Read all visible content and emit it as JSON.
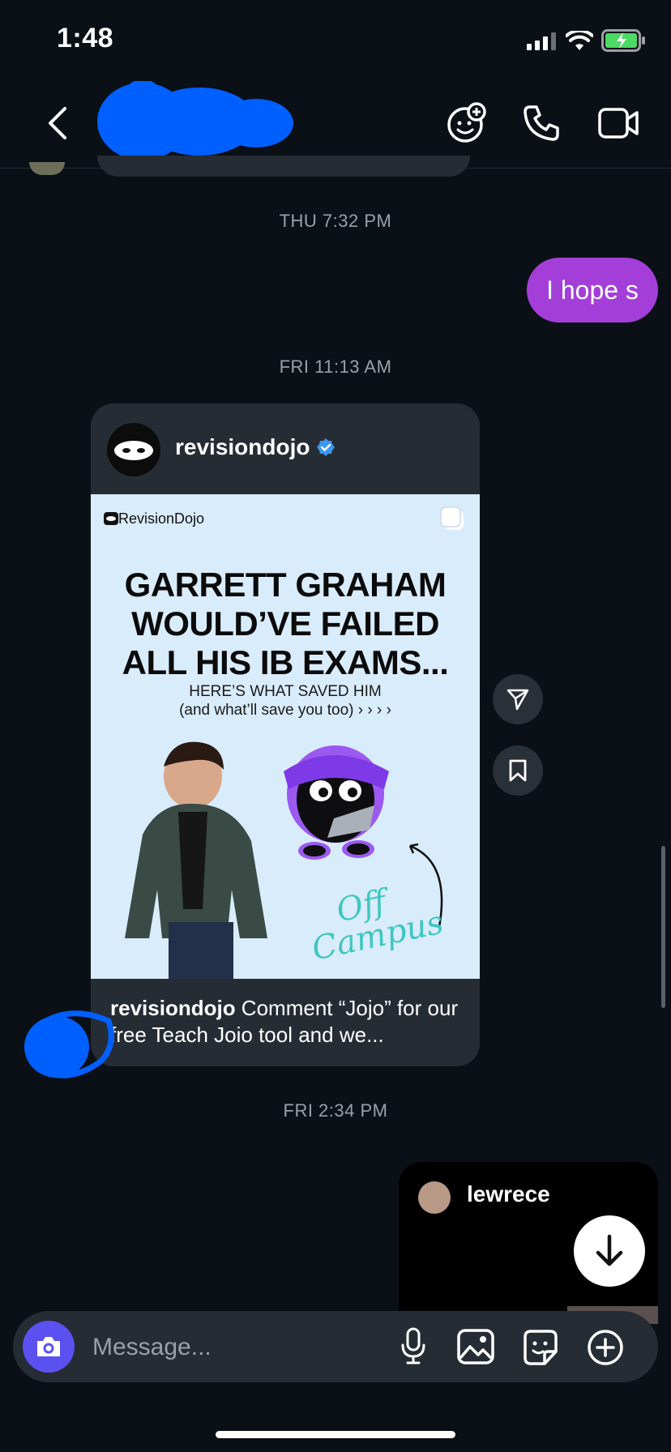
{
  "status_bar": {
    "time": "1:48",
    "battery_icon": "battery-charging-icon"
  },
  "header": {
    "contact_name": "",
    "icons": [
      "back-chevron-icon",
      "sticker-add-icon",
      "phone-icon",
      "video-camera-icon"
    ]
  },
  "thread": {
    "timestamps": [
      "THU 7:32 PM",
      "FRI 11:13 AM",
      "FRI 2:34 PM"
    ],
    "outgoing_message": "I hope s",
    "shared_post": {
      "username": "revisiondojo",
      "verified": true,
      "brand_name": "RevisionDojo",
      "headline_lines": [
        "GARRETT GRAHAM",
        "WOULD’VE FAILED",
        "ALL HIS IB EXAMS..."
      ],
      "subhead_lines": [
        "HERE’S WHAT SAVED HIM",
        "(and what’ll save you too) › › › ›"
      ],
      "doodle_text": "Off Campus",
      "caption_user": "revisiondojo",
      "caption_text": " Comment “Jojo” for our free Teach Joio tool and we..."
    },
    "shared_reel": {
      "username": "lewrece"
    }
  },
  "composer": {
    "placeholder": "Message..."
  },
  "colors": {
    "background": "#0b1017",
    "outgoing_bubble": "#a33fd8",
    "card": "#262c33",
    "post_background": "#d9ecfb",
    "camera_button": "#5b51f0",
    "verified_badge": "#3897f0"
  }
}
